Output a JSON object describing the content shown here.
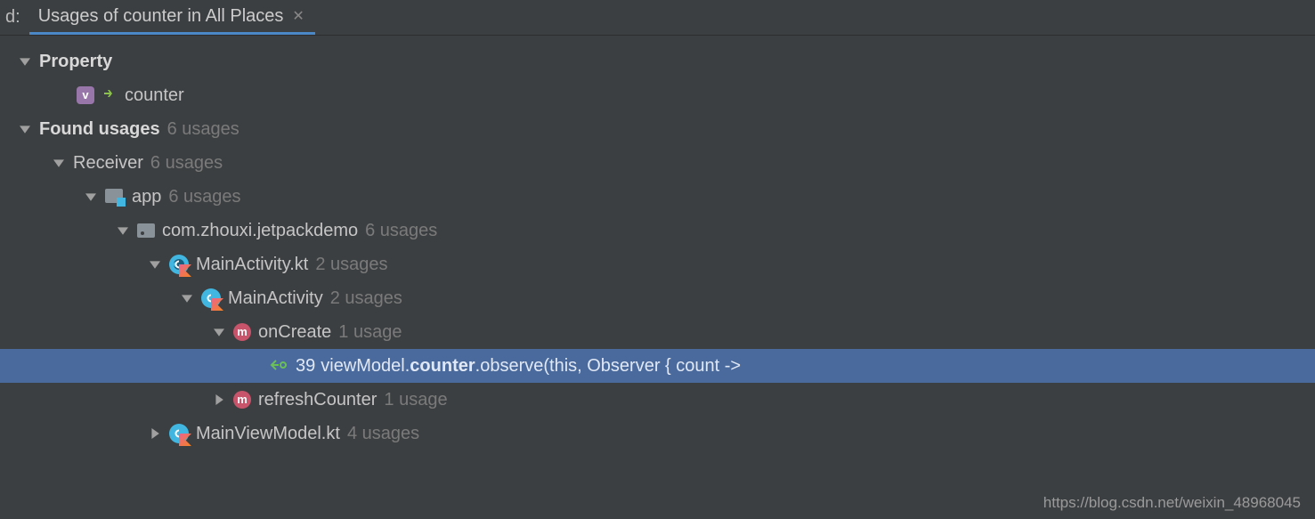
{
  "tab": {
    "prefix": "d:",
    "title": "Usages of counter in All Places"
  },
  "tree": {
    "property": {
      "heading": "Property",
      "name": "counter",
      "v_letter": "v"
    },
    "found": {
      "heading": "Found usages",
      "usages": "6 usages"
    },
    "receiver": {
      "label": "Receiver",
      "usages": "6 usages"
    },
    "app": {
      "label": "app",
      "usages": "6 usages"
    },
    "pkg": {
      "label": "com.zhouxi.jetpackdemo",
      "usages": "6 usages"
    },
    "file1": {
      "label": "MainActivity.kt",
      "usages": "2 usages"
    },
    "class1": {
      "label": "MainActivity",
      "usages": "2 usages"
    },
    "method1": {
      "label": "onCreate",
      "usages": "1 usage"
    },
    "usage_line": {
      "num": "39",
      "pre": "viewModel.",
      "hl": "counter",
      "post": ".observe(this, Observer { count ->"
    },
    "method2": {
      "label": "refreshCounter",
      "usages": "1 usage"
    },
    "file2": {
      "label": "MainViewModel.kt",
      "usages": "4 usages"
    }
  },
  "watermark": "https://blog.csdn.net/weixin_48968045"
}
